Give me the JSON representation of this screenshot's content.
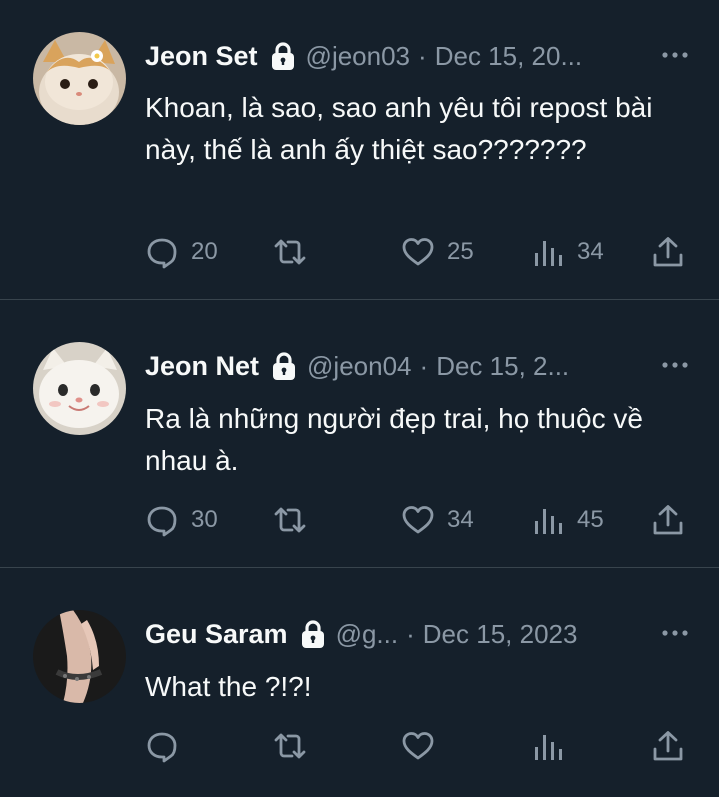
{
  "tweets": [
    {
      "name": "Jeon Set",
      "handle": "@jeon03",
      "sep": "·",
      "date": "Dec 15, 20...",
      "text": "Khoan, là sao, sao anh yêu tôi repost bài này, thế là anh ấy thiệt sao???????",
      "replies": "20",
      "retweets": "",
      "likes": "25",
      "views": "34",
      "avatar": "cat-with-flower-avatar"
    },
    {
      "name": "Jeon Net",
      "handle": "@jeon04",
      "sep": "·",
      "date": "Dec 15, 2...",
      "text": "Ra là những người đẹp trai, họ thuộc về nhau à.",
      "replies": "30",
      "retweets": "",
      "likes": "34",
      "views": "45",
      "avatar": "smiling-white-cat-avatar"
    },
    {
      "name": "Geu Saram",
      "handle": "@g...",
      "sep": "·",
      "date": "Dec 15, 2023",
      "text": "What the ?!?!",
      "replies": "",
      "retweets": "",
      "likes": "",
      "views": "",
      "avatar": "hand-with-bracelet-avatar"
    }
  ],
  "icons": {
    "lock": "lock-icon",
    "more": "more-icon",
    "reply": "reply-icon",
    "retweet": "retweet-icon",
    "like": "like-icon",
    "views": "views-icon",
    "share": "share-icon"
  },
  "colors": {
    "background": "#15202b",
    "text": "#f7f9f9",
    "muted": "#8b98a5",
    "divider": "#38444d"
  }
}
